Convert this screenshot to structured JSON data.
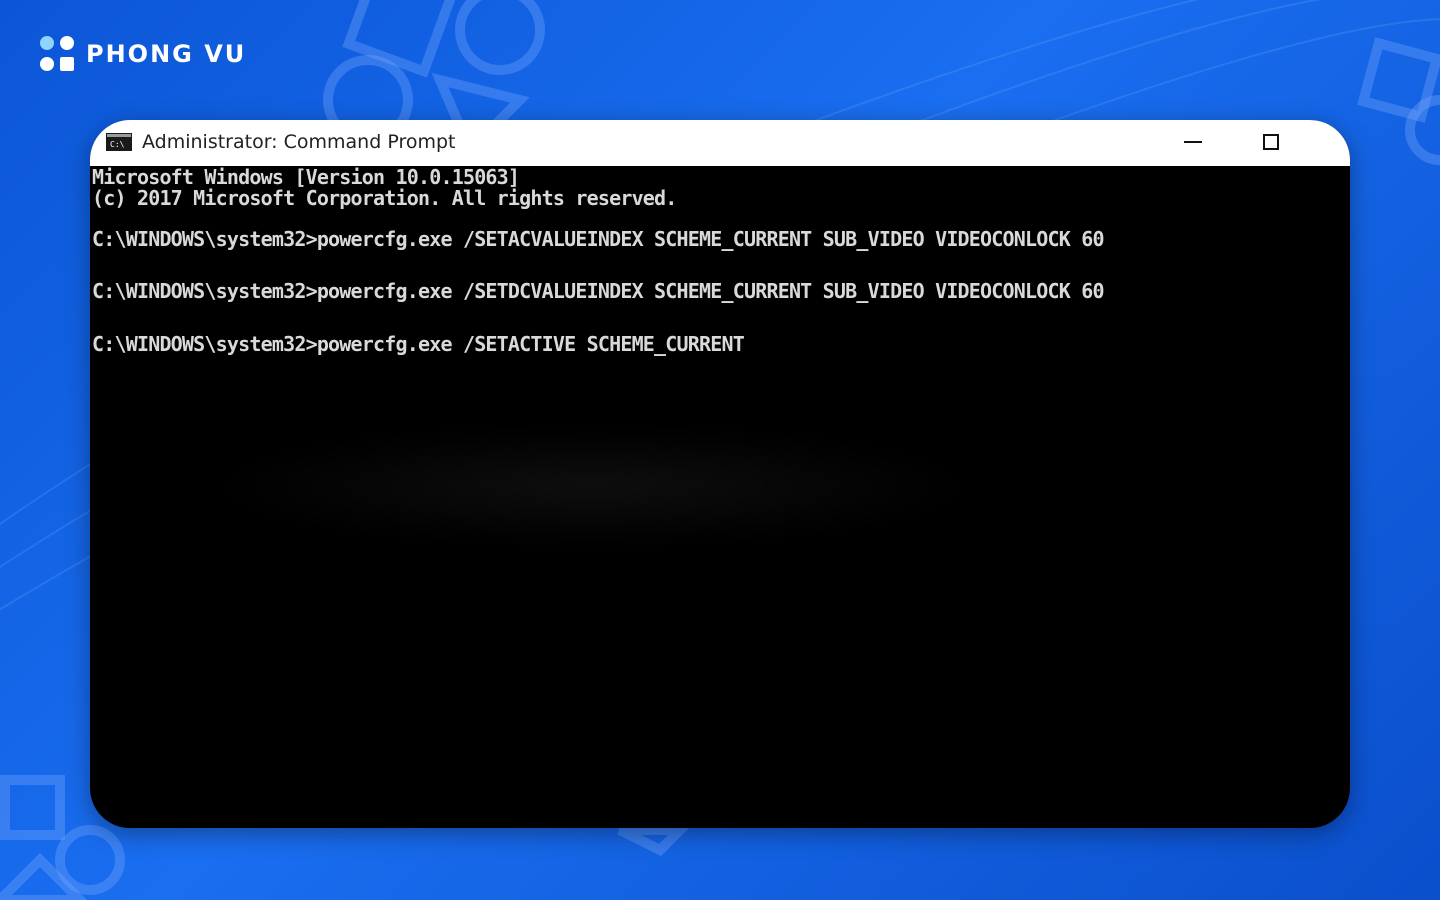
{
  "brand": {
    "name": "PHONG VU",
    "logo_icon": "four-dots-logo-icon"
  },
  "window": {
    "title": "Administrator: Command Prompt",
    "app_icon": "cmd-icon",
    "minimize_icon": "minimize-icon",
    "maximize_icon": "maximize-icon"
  },
  "console": {
    "lines": [
      "Microsoft Windows [Version 10.0.15063]",
      "(c) 2017 Microsoft Corporation. All rights reserved.",
      "C:\\WINDOWS\\system32>powercfg.exe /SETACVALUEINDEX SCHEME_CURRENT SUB_VIDEO VIDEOCONLOCK 60",
      "C:\\WINDOWS\\system32>powercfg.exe /SETDCVALUEINDEX SCHEME_CURRENT SUB_VIDEO VIDEOCONLOCK 60",
      "C:\\WINDOWS\\system32>powercfg.exe /SETACTIVE SCHEME_CURRENT"
    ]
  },
  "colors": {
    "background": "#0b56d6",
    "console_bg": "#000000",
    "console_text": "#d9d9d9",
    "titlebar_bg": "#ffffff"
  }
}
